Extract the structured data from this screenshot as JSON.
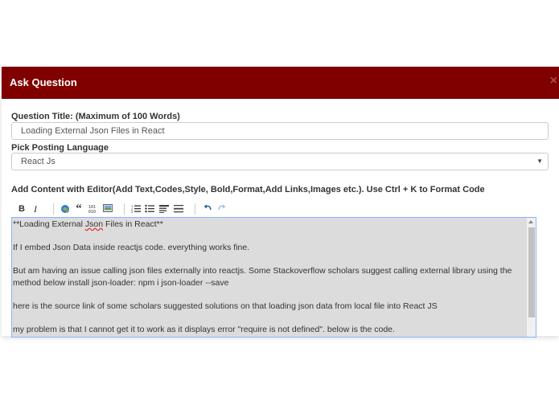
{
  "modal": {
    "title": "Ask Question",
    "close_glyph": "×"
  },
  "question_title": {
    "label": "Question Title: (Maximum of 100 Words)",
    "value": "Loading External Json Files in React"
  },
  "language": {
    "label": "Pick Posting Language",
    "selected": "React Js",
    "arrow": "▼"
  },
  "content": {
    "label": "Add Content with Editor(Add Text,Codes,Style, Bold,Format,Add Links,Images etc.). Use Ctrl + K to Format Code"
  },
  "toolbar": {
    "bold": "B",
    "italic": "I",
    "quote": "“",
    "code": "101\n010",
    "icons": [
      "bold-icon",
      "italic-icon",
      "link-icon",
      "quote-icon",
      "code-icon",
      "image-icon",
      "numbered-list-icon",
      "bulleted-list-icon",
      "heading-icon",
      "horizontal-rule-icon",
      "undo-icon",
      "redo-icon"
    ]
  },
  "editor": {
    "line1_pre": "**Loading External ",
    "line1_spell": "Json",
    "line1_post": " Files in React**",
    "para2": "If I embed Json Data inside reactjs code. everything works fine.",
    "para3": "But am having an issue calling json files externally into reactjs. Some Stackoverflow scholars suggest calling external library using the method below install json-loader: npm i json-loader --save",
    "para4": "here is the source link of some scholars suggested solutions on that loading json data from local file into React JS",
    "para5": "my problem is that I cannot get it to work as it displays error \"require is not defined\". below is the code."
  },
  "colors": {
    "header_bg": "#800000",
    "editor_bg": "#dcdcdc",
    "focus_border": "#8ab4f8"
  }
}
